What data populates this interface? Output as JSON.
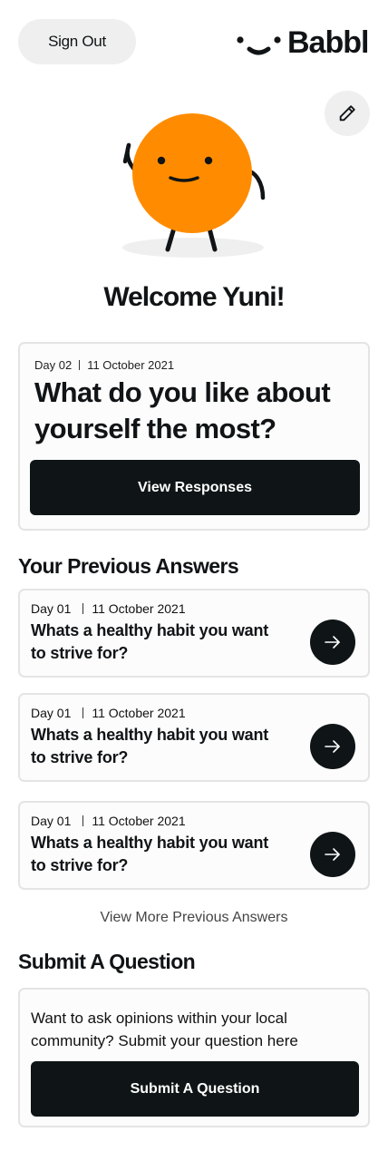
{
  "header": {
    "signout_label": "Sign Out",
    "logo_text": "Babbl"
  },
  "welcome": "Welcome Yuni!",
  "today": {
    "day": "Day 02",
    "date": "11 October 2021",
    "question": "What do you like about yourself the most?",
    "button_label": "View Responses"
  },
  "previous": {
    "title": "Your Previous Answers",
    "items": [
      {
        "day": "Day 01",
        "date": "11 October 2021",
        "question": "Whats a healthy habit you want to strive for?"
      },
      {
        "day": "Day 01",
        "date": "11 October 2021",
        "question": "Whats a healthy habit you want to strive for?"
      },
      {
        "day": "Day 01",
        "date": "11 October 2021",
        "question": "Whats a healthy habit you want to strive for?"
      }
    ],
    "view_more_label": "View More Previous Answers"
  },
  "submit": {
    "title": "Submit A Question",
    "description": "Want to ask opinions within your local community? Submit your question here",
    "button_label": "Submit A Question"
  },
  "colors": {
    "accent": "#ff8c00",
    "dark": "#0f1416",
    "light_gray": "#efefef",
    "card_border": "#e4e4e4"
  },
  "icons": {
    "edit": "pencil-icon",
    "arrow": "arrow-right-icon",
    "logo": "smile-logo-icon",
    "mascot": "orange-ball-mascot"
  }
}
